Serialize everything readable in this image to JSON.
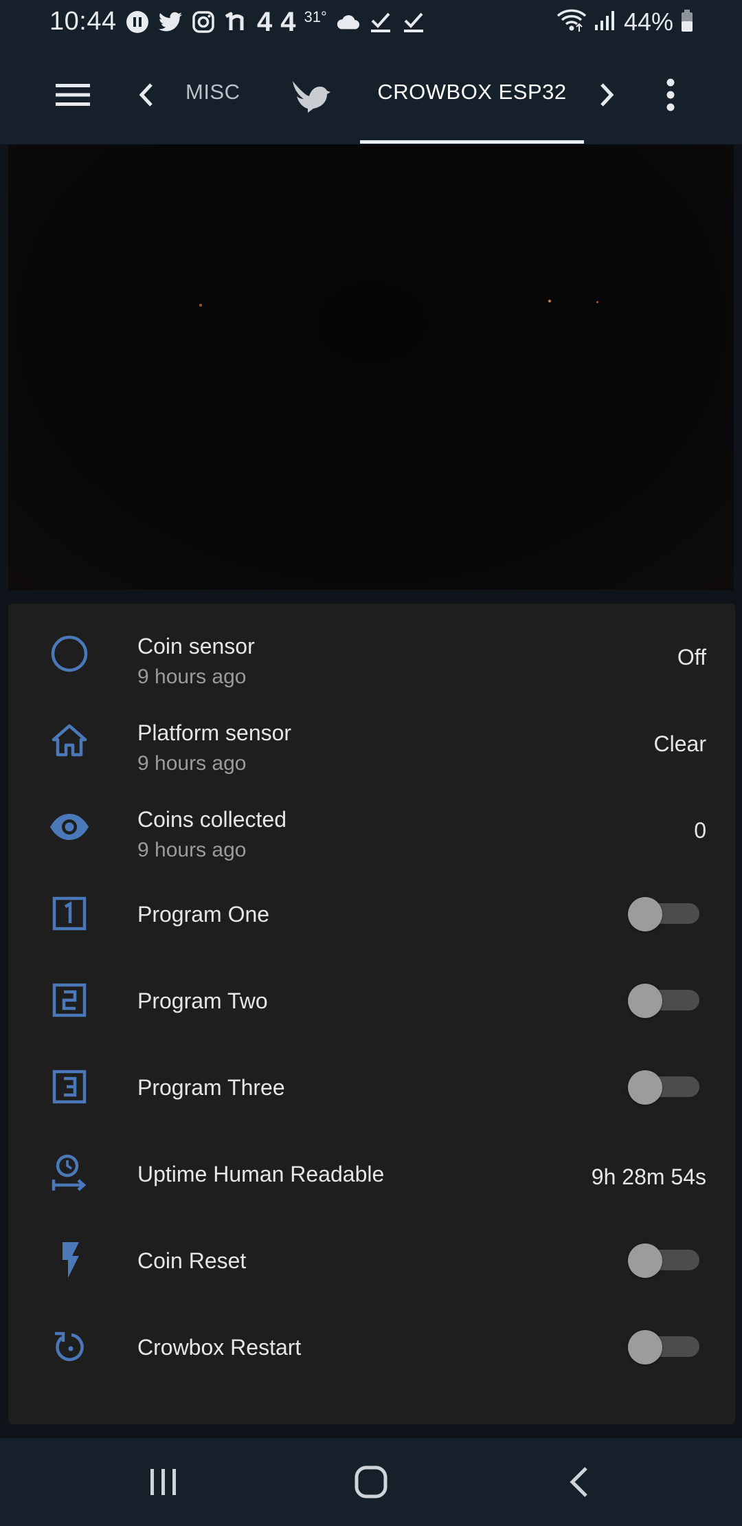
{
  "status_bar": {
    "time": "10:44",
    "weather_temp": "31°",
    "notif_num_1": "4",
    "notif_num_2": "4",
    "battery_text": "44%"
  },
  "app_bar": {
    "tabs": [
      {
        "label": "MISC"
      },
      {
        "label": "CROWBOX ESP32"
      }
    ],
    "active_tab": "CROWBOX ESP32"
  },
  "entities": [
    {
      "name": "Coin sensor",
      "secondary": "9 hours ago",
      "state": "Off",
      "icon": "circle-outline-icon"
    },
    {
      "name": "Platform sensor",
      "secondary": "9 hours ago",
      "state": "Clear",
      "icon": "home-icon"
    },
    {
      "name": "Coins collected",
      "secondary": "9 hours ago",
      "state": "0",
      "icon": "eye-icon"
    },
    {
      "name": "Program One",
      "toggle": false,
      "icon": "numeric-1-box-icon"
    },
    {
      "name": "Program Two",
      "toggle": false,
      "icon": "numeric-2-box-icon"
    },
    {
      "name": "Program Three",
      "toggle": false,
      "icon": "numeric-3-box-icon"
    },
    {
      "name": "Uptime Human Readable",
      "state": "9h 28m 54s",
      "icon": "clock-arrow-icon"
    },
    {
      "name": "Coin Reset",
      "toggle": false,
      "icon": "flash-icon"
    },
    {
      "name": "Crowbox Restart",
      "toggle": false,
      "icon": "restart-icon"
    }
  ],
  "colors": {
    "accent": "#4a78b8",
    "appbar_bg": "#16202a",
    "card_bg": "#1e1e1f",
    "toggle_off_thumb": "#9c9c9c",
    "toggle_off_track": "#4c4c4c"
  }
}
